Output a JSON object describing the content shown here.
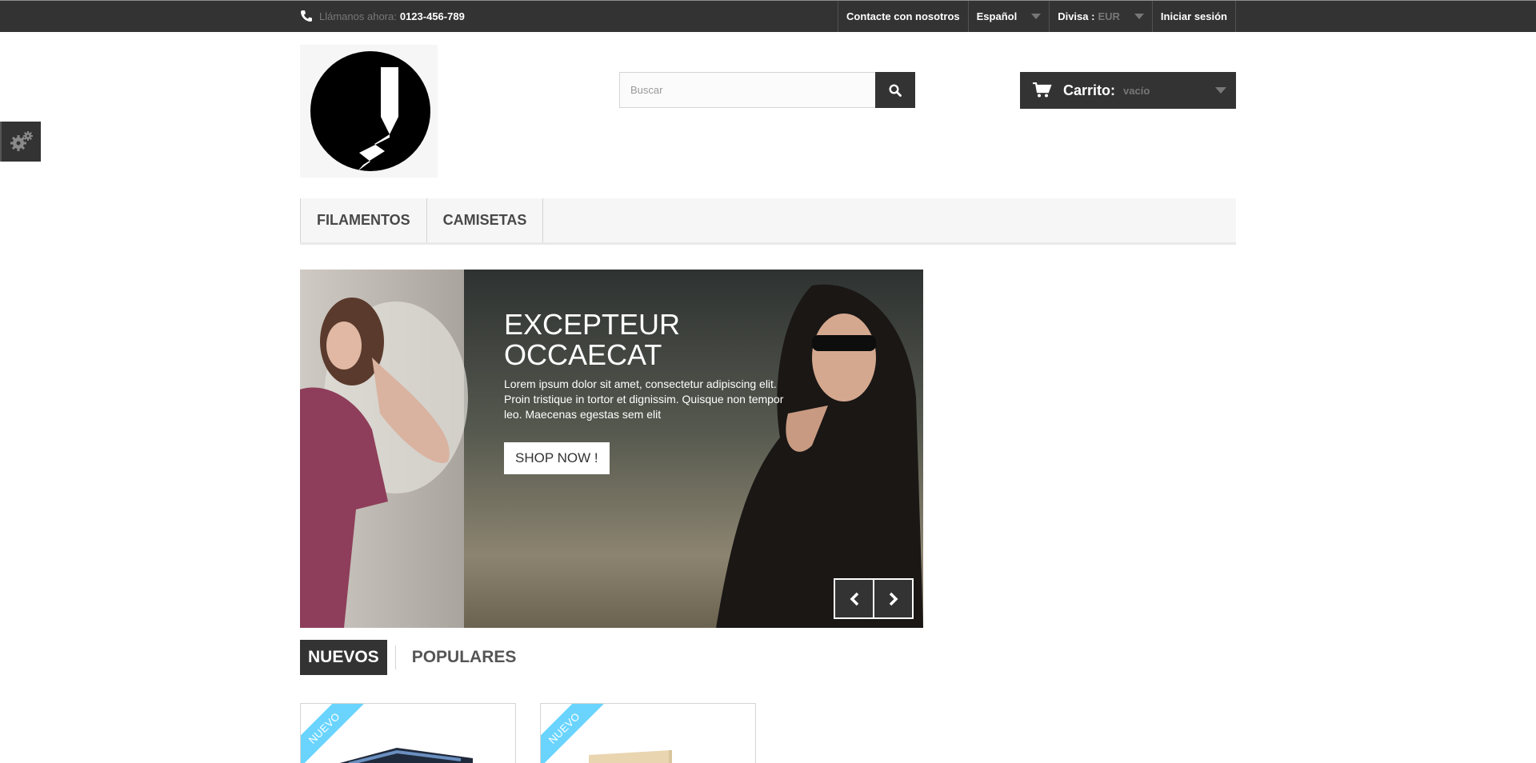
{
  "topbar": {
    "call_label": "Llámanos ahora:",
    "phone": "0123-456-789",
    "contact": "Contacte con nosotros",
    "language": "Español",
    "currency_label": "Divisa :",
    "currency_value": "EUR",
    "login": "Iniciar sesión"
  },
  "search": {
    "placeholder": "Buscar"
  },
  "cart": {
    "label": "Carrito:",
    "status": "vacío"
  },
  "menu": {
    "items": [
      "FILAMENTOS",
      "CAMISETAS"
    ]
  },
  "slider": {
    "title_line1": "EXCEPTEUR",
    "title_line2": "OCCAECAT",
    "text": "Lorem ipsum dolor sit amet, consectetur adipiscing elit. Proin tristique in tortor et dignissim. Quisque non tempor leo. Maecenas egestas sem elit",
    "button": "SHOP NOW !"
  },
  "tabs": {
    "active": "NUEVOS",
    "other": "POPULARES"
  },
  "products": [
    {
      "badge": "NUEVO"
    },
    {
      "badge": "NUEVO"
    }
  ],
  "colors": {
    "dark": "#333333",
    "ribbon": "#6ad4ff",
    "menu_bg": "#f6f6f6"
  }
}
